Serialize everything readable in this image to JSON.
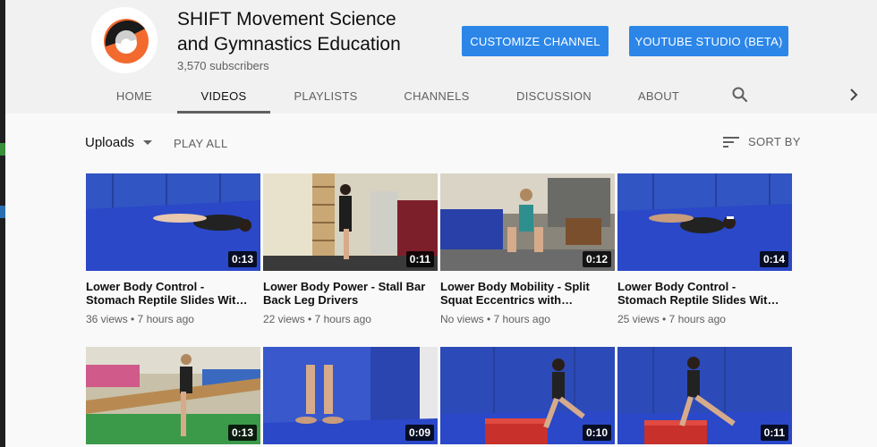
{
  "channel": {
    "name_line1": "SHIFT Movement Science",
    "name_line2": "and Gymnastics Education",
    "subscribers": "3,570 subscribers"
  },
  "buttons": {
    "customize": "CUSTOMIZE CHANNEL",
    "studio": "YOUTUBE STUDIO (BETA)"
  },
  "tabs": [
    {
      "label": "HOME"
    },
    {
      "label": "VIDEOS",
      "active": true
    },
    {
      "label": "PLAYLISTS"
    },
    {
      "label": "CHANNELS"
    },
    {
      "label": "DISCUSSION"
    },
    {
      "label": "ABOUT"
    }
  ],
  "toolbar": {
    "uploads_label": "Uploads",
    "play_all": "PLAY ALL",
    "sort_by": "SORT BY"
  },
  "videos": [
    {
      "title": "Lower Body Control - Stomach Reptile Slides Wit…",
      "meta": "36 views • 7 hours ago",
      "duration": "0:13"
    },
    {
      "title": "Lower Body Power - Stall Bar Back Leg Drivers",
      "meta": "22 views • 7 hours ago",
      "duration": "0:11"
    },
    {
      "title": "Lower Body Mobility - Split Squat Eccentrics with…",
      "meta": "No views • 7 hours ago",
      "duration": "0:12"
    },
    {
      "title": "Lower Body Control - Stomach Reptile Slides Wit…",
      "meta": "25 views • 7 hours ago",
      "duration": "0:14"
    },
    {
      "duration": "0:13"
    },
    {
      "duration": "0:09"
    },
    {
      "duration": "0:10"
    },
    {
      "duration": "0:11"
    }
  ],
  "colors": {
    "accent_blue": "#2c86e8",
    "logo_orange": "#f26a2e"
  },
  "icons": {
    "search": "search-icon",
    "next": "chevron-right-icon",
    "sort": "sort-icon",
    "dropdown": "caret-down-icon"
  }
}
